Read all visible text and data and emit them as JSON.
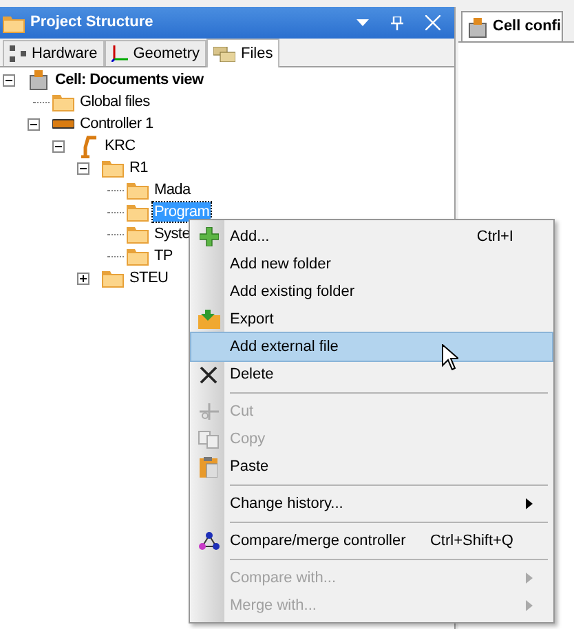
{
  "panel": {
    "title": "Project Structure",
    "tabs": [
      {
        "label": "Hardware",
        "selected": false
      },
      {
        "label": "Geometry",
        "selected": false
      },
      {
        "label": "Files",
        "selected": true
      }
    ]
  },
  "tree": [
    {
      "label": "Cell: Documents view",
      "bold": true,
      "expanded": true,
      "selected": false,
      "children": [
        {
          "label": "Global files",
          "selected": false
        },
        {
          "label": "Controller 1",
          "expanded": true,
          "selected": false,
          "children": [
            {
              "label": "KRC",
              "expanded": true,
              "selected": false,
              "children": [
                {
                  "label": "R1",
                  "expanded": true,
                  "selected": false,
                  "children": [
                    {
                      "label": "Mada",
                      "selected": false
                    },
                    {
                      "label": "Program",
                      "selected": true
                    },
                    {
                      "label": "Syste",
                      "selected": false
                    },
                    {
                      "label": "TP",
                      "selected": false
                    }
                  ]
                },
                {
                  "label": "STEU",
                  "expanded": false,
                  "selected": false
                }
              ]
            }
          ]
        }
      ]
    }
  ],
  "context_menu": {
    "items": [
      {
        "kind": "item",
        "label": "Add...",
        "shortcut": "Ctrl+I",
        "disabled": false,
        "selected": false
      },
      {
        "kind": "item",
        "label": "Add new folder",
        "disabled": false,
        "selected": false
      },
      {
        "kind": "item",
        "label": "Add existing folder",
        "disabled": false,
        "selected": false
      },
      {
        "kind": "item",
        "label": "Export",
        "disabled": false,
        "selected": false
      },
      {
        "kind": "item",
        "label": "Add external file",
        "disabled": false,
        "selected": true
      },
      {
        "kind": "item",
        "label": "Delete",
        "disabled": false,
        "selected": false
      },
      {
        "kind": "separator"
      },
      {
        "kind": "item",
        "label": "Cut",
        "disabled": true,
        "selected": false
      },
      {
        "kind": "item",
        "label": "Copy",
        "disabled": true,
        "selected": false
      },
      {
        "kind": "item",
        "label": "Paste",
        "disabled": false,
        "selected": false
      },
      {
        "kind": "separator"
      },
      {
        "kind": "submenu",
        "label": "Change history...",
        "disabled": false,
        "selected": false
      },
      {
        "kind": "separator"
      },
      {
        "kind": "item",
        "label": "Compare/merge controller",
        "shortcut": "Ctrl+Shift+Q",
        "disabled": false,
        "selected": false
      },
      {
        "kind": "separator"
      },
      {
        "kind": "submenu",
        "label": "Compare with...",
        "disabled": true,
        "selected": false
      },
      {
        "kind": "submenu",
        "label": "Merge with...",
        "disabled": true,
        "selected": false
      }
    ]
  },
  "document_tab": {
    "label": "Cell confi",
    "selected": true
  }
}
